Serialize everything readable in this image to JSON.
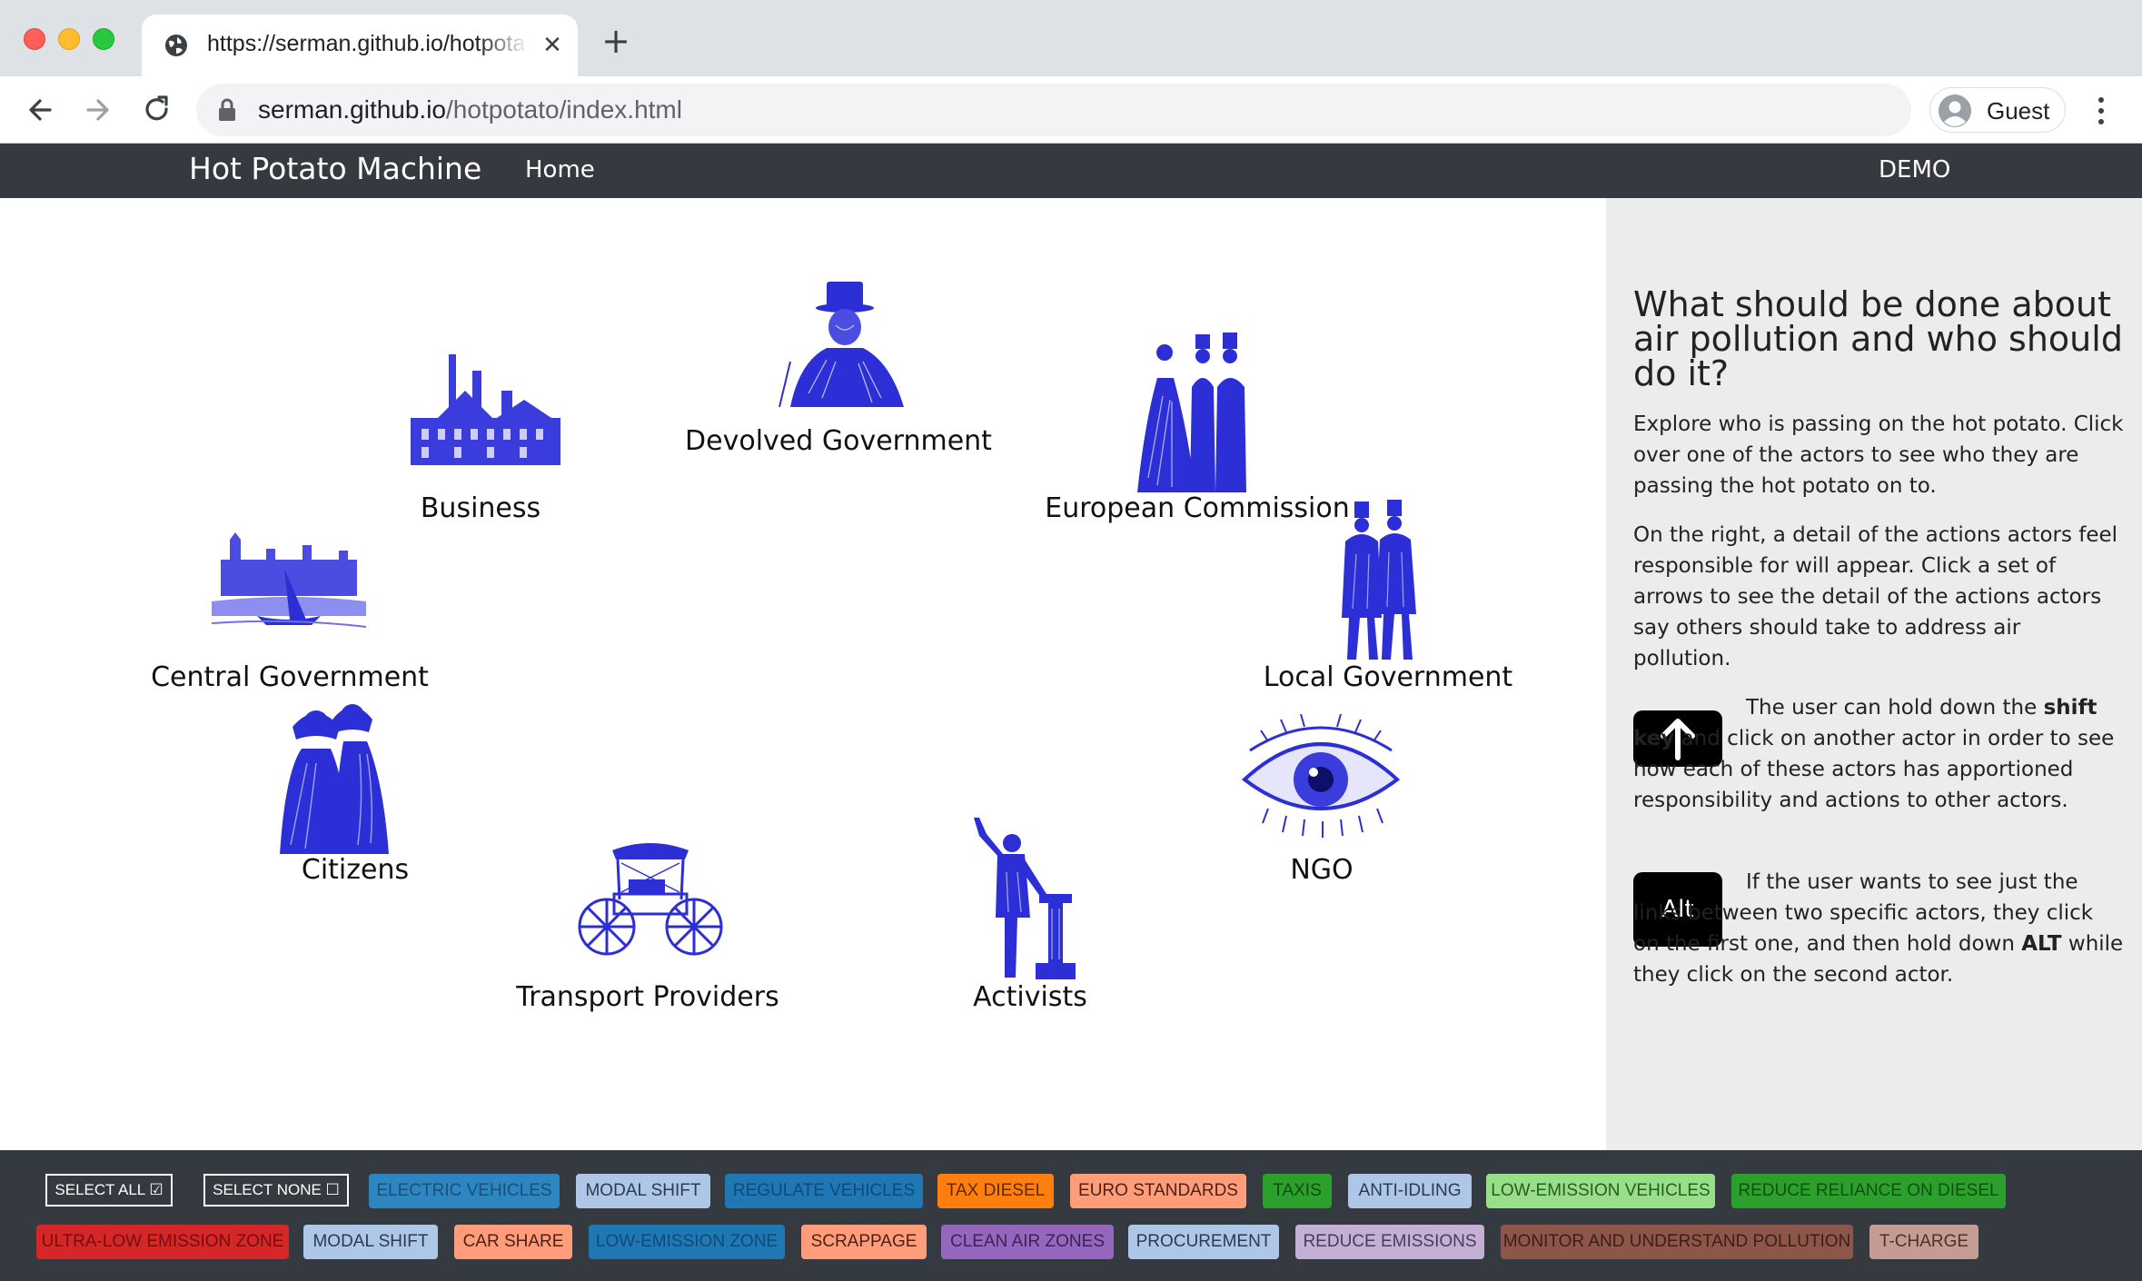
{
  "browser": {
    "tab_title": "https://serman.github.io/hotpotato/index.html",
    "url_domain": "serman.github.io",
    "url_path": "/hotpotato/index.html",
    "profile_name": "Guest"
  },
  "navbar": {
    "brand": "Hot Potato Machine",
    "home": "Home",
    "demo": "DEMO"
  },
  "actors": [
    {
      "label": "Devolved Government",
      "icon": "top-hat-man-icon"
    },
    {
      "label": "Business",
      "icon": "factory-icon"
    },
    {
      "label": "European Commission",
      "icon": "victorian-group-icon"
    },
    {
      "label": "Central Government",
      "icon": "parliament-icon"
    },
    {
      "label": "Local Government",
      "icon": "two-gentlemen-icon"
    },
    {
      "label": "Citizens",
      "icon": "two-women-icon"
    },
    {
      "label": "NGO",
      "icon": "eye-icon"
    },
    {
      "label": "Transport Providers",
      "icon": "carriage-icon"
    },
    {
      "label": "Activists",
      "icon": "orator-icon"
    }
  ],
  "sidebar": {
    "heading": "What should be done about air pollution and who should do it?",
    "p1": "Explore who is passing on the hot potato. Click over one of the actors to see who they are passing the hot potato on to.",
    "p2": "On the right, a detail of the actions actors feel responsible for will appear. Click a set of arrows to see the detail of the actions actors say others should take to address air pollution.",
    "shift_text_a": "The user can hold down the ",
    "shift_bold": "shift key",
    "shift_text_b": " and click on another actor in order to see how each of these actors has apportioned responsibility and actions to other actors.",
    "alt_key_label": "Alt",
    "alt_text_a": "If the user wants to see just the links between two specific actors, they click on the first one, and then hold down ",
    "alt_bold": "ALT",
    "alt_text_b": " while they click on the second actor."
  },
  "filters": {
    "select_all": "SELECT ALL ☑",
    "select_none": "SELECT NONE ☐",
    "row1": [
      {
        "label": "ELECTRIC VEHICLES",
        "bg": "#2e86c1",
        "fg": "#1c4f77"
      },
      {
        "label": "MODAL SHIFT",
        "bg": "#aec7e8",
        "fg": "#2d3a4d"
      },
      {
        "label": "REGULATE VEHICLES",
        "bg": "#1f77b4",
        "fg": "#124a73"
      },
      {
        "label": "TAX DIESEL",
        "bg": "#ff7f0e",
        "fg": "#5a2a00"
      },
      {
        "label": "EURO STANDARDS",
        "bg": "#ff9d7a",
        "fg": "#4a2318"
      },
      {
        "label": "TAXIS",
        "bg": "#2ca02c",
        "fg": "#124d12"
      },
      {
        "label": "ANTI-IDLING",
        "bg": "#aec7e8",
        "fg": "#2d3a4d"
      },
      {
        "label": "LOW-EMISSION VEHICLES",
        "bg": "#98df8a",
        "fg": "#2c5a24"
      },
      {
        "label": "REDUCE RELIANCE ON DIESEL",
        "bg": "#2ca02c",
        "fg": "#124d12"
      }
    ],
    "row2": [
      {
        "label": "ULTRA-LOW EMISSION ZONE",
        "bg": "#d62728",
        "fg": "#6e0f10"
      },
      {
        "label": "MODAL SHIFT",
        "bg": "#aec7e8",
        "fg": "#2d3a4d"
      },
      {
        "label": "CAR SHARE",
        "bg": "#ff9d7a",
        "fg": "#4a2318"
      },
      {
        "label": "LOW-EMISSION ZONE",
        "bg": "#1f77b4",
        "fg": "#124a73"
      },
      {
        "label": "SCRAPPAGE",
        "bg": "#ff9d7a",
        "fg": "#4a2318"
      },
      {
        "label": "CLEAN AIR ZONES",
        "bg": "#9467bd",
        "fg": "#3c2356"
      },
      {
        "label": "PROCUREMENT",
        "bg": "#aec7e8",
        "fg": "#2d3a4d"
      },
      {
        "label": "REDUCE EMISSIONS",
        "bg": "#c5b0d5",
        "fg": "#4a3a5c"
      },
      {
        "label": "MONITOR AND UNDERSTAND POLLUTION",
        "bg": "#8c564b",
        "fg": "#3a1e18"
      },
      {
        "label": "T-CHARGE",
        "bg": "#c49c94",
        "fg": "#4a322d"
      }
    ]
  },
  "colors": {
    "accent_blue": "#2d2fd6",
    "navbar_bg": "#343a40",
    "sidebar_bg": "#ececec"
  }
}
